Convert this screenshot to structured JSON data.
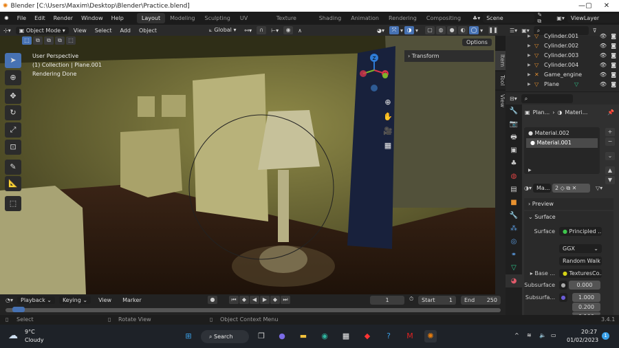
{
  "window": {
    "title": "Blender [C:\\Users\\Maxim\\Desktop\\Blender\\Practice.blend]",
    "minimize": "—",
    "maximize": "▢",
    "close": "✕"
  },
  "menu": [
    "File",
    "Edit",
    "Render",
    "Window",
    "Help"
  ],
  "workspaces": [
    "Layout",
    "Modeling",
    "Sculpting",
    "UV Editing",
    "Texture Paint",
    "Shading",
    "Animation",
    "Rendering",
    "Compositing"
  ],
  "scene": "Scene",
  "view_layer": "ViewLayer",
  "viewport_header": {
    "mode": "Object Mode",
    "menus": [
      "View",
      "Select",
      "Add",
      "Object"
    ],
    "orientation": "Global",
    "options": "Options"
  },
  "overlay": {
    "line1": "User Perspective",
    "line2": "(1) Collection | Plane.001",
    "line3": "Rendering Done"
  },
  "n_panel": {
    "tabs": [
      "Item",
      "Tool",
      "View"
    ],
    "transform": "Transform"
  },
  "gizmo": {
    "x": "X",
    "y": "Y",
    "z": "Z"
  },
  "outliner": {
    "items": [
      {
        "name": "Cylinder.001",
        "type": "mesh"
      },
      {
        "name": "Cylinder.002",
        "type": "mesh"
      },
      {
        "name": "Cylinder.003",
        "type": "mesh"
      },
      {
        "name": "Cylinder.004",
        "type": "mesh"
      },
      {
        "name": "Game_engine",
        "type": "armature"
      },
      {
        "name": "Plane",
        "type": "mesh"
      }
    ]
  },
  "properties": {
    "breadcrumb": {
      "object": "Plan...",
      "material": "Materi..."
    },
    "slots": [
      "Material.002",
      "Material.001"
    ],
    "selected_slot": "Material.001",
    "material_name": "Ma...",
    "users": "2",
    "preview": "Preview",
    "surface_panel": "Surface",
    "surface_label": "Surface",
    "surface_value": "Principled ...",
    "distribution": "GGX",
    "subsurface_method": "Random Walk",
    "base_label": "Base ...",
    "base_value": "TexturesCo...",
    "subsurface_label": "Subsurface",
    "subsurface_value": "0.000",
    "radius_label": "Subsurfa...",
    "radius": [
      "1.000",
      "0.200",
      "0.100"
    ],
    "colors": {
      "surface_dot": "#3ec64c",
      "base_dot": "#d6d415",
      "radius_dot": "#6b5cd6",
      "subsurface_dot": "#a0a0a0"
    }
  },
  "timeline": {
    "menus": [
      "Playback",
      "Keying",
      "View",
      "Marker"
    ],
    "current_frame": "1",
    "start_label": "Start",
    "start": "1",
    "end_label": "End",
    "end": "250"
  },
  "status": {
    "select": "Select",
    "rotate": "Rotate View",
    "context": "Object Context Menu",
    "version": "3.4.1"
  },
  "taskbar": {
    "temp": "9°C",
    "weather": "Cloudy",
    "search": "Search",
    "time": "20:27",
    "date": "01/02/2023",
    "notifications": "1"
  },
  "colors": {
    "accent": "#4772b3",
    "active_tab": "#303030",
    "blender_orange": "#e87d0d"
  }
}
